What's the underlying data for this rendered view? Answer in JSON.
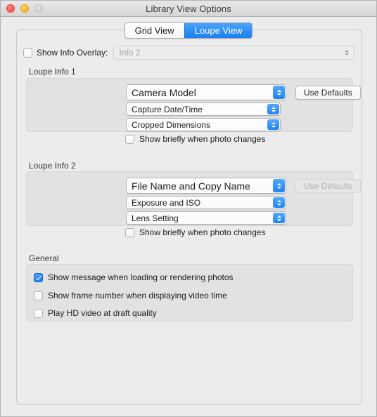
{
  "window": {
    "title": "Library View Options",
    "traffic_lights": [
      "close",
      "minimize",
      "zoom"
    ]
  },
  "tabs": [
    {
      "label": "Grid View",
      "active": false
    },
    {
      "label": "Loupe View",
      "active": true
    }
  ],
  "overlay": {
    "checkbox_label": "Show Info Overlay:",
    "checked": false,
    "popup_value": "Info 2",
    "enabled": false
  },
  "loupe_info_1": {
    "title": "Loupe Info 1",
    "fields": [
      {
        "value": "Camera Model"
      },
      {
        "value": "Capture Date/Time"
      },
      {
        "value": "Cropped Dimensions"
      }
    ],
    "use_defaults_label": "Use Defaults",
    "use_defaults_enabled": true,
    "show_briefly_label": "Show briefly when photo changes",
    "show_briefly_checked": false
  },
  "loupe_info_2": {
    "title": "Loupe Info 2",
    "fields": [
      {
        "value": "File Name and Copy Name"
      },
      {
        "value": "Exposure and ISO"
      },
      {
        "value": "Lens Setting"
      }
    ],
    "use_defaults_label": "Use Defaults",
    "use_defaults_enabled": false,
    "show_briefly_label": "Show briefly when photo changes",
    "show_briefly_checked": false
  },
  "general": {
    "title": "General",
    "options": [
      {
        "label": "Show message when loading or rendering photos",
        "checked": true
      },
      {
        "label": "Show frame number when displaying video time",
        "checked": false
      },
      {
        "label": "Play HD video at draft quality",
        "checked": false
      }
    ]
  },
  "colors": {
    "accent_blue": "#1f7ef0",
    "window_bg": "#ececec",
    "panel_bg": "#e2e2e2"
  }
}
